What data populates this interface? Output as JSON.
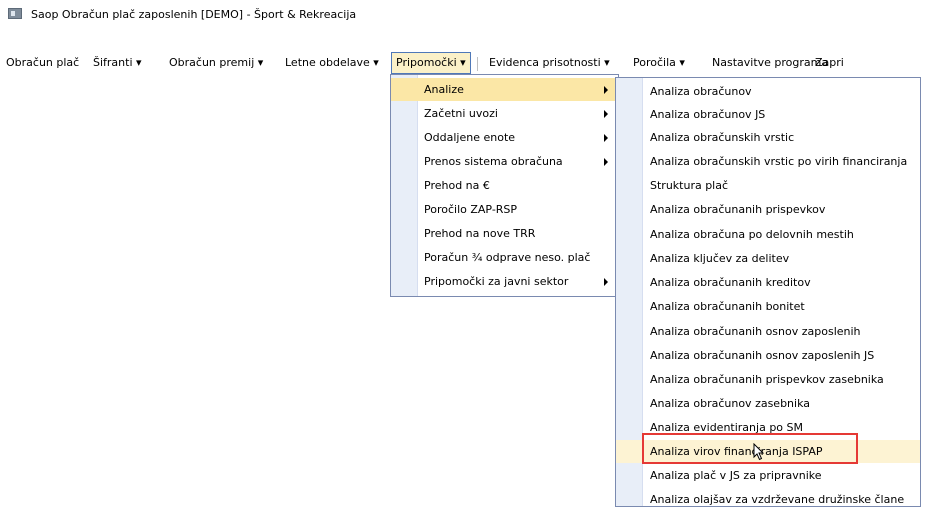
{
  "window": {
    "title": "Saop Obračun plač zaposlenih  [DEMO] - Šport & Rekreacija"
  },
  "menubar": {
    "items": [
      {
        "label": "Obračun plač"
      },
      {
        "label": "Šifranti ▾"
      },
      {
        "label": "Obračun premij ▾"
      },
      {
        "label": "Letne obdelave ▾"
      },
      {
        "label": "Pripomočki ▾"
      },
      {
        "label": "Evidenca prisotnosti ▾"
      },
      {
        "label": "Poročila ▾"
      },
      {
        "label": "Nastavitve programa"
      },
      {
        "label": "Zapri"
      }
    ]
  },
  "pripomocki_menu": {
    "items": [
      {
        "label": "Analize",
        "has_submenu": true
      },
      {
        "label": "Začetni uvozi",
        "has_submenu": true
      },
      {
        "label": "Oddaljene enote",
        "has_submenu": true
      },
      {
        "label": "Prenos sistema obračuna",
        "has_submenu": true
      },
      {
        "label": "Prehod na €"
      },
      {
        "label": "Poročilo ZAP-RSP"
      },
      {
        "label": "Prehod na nove TRR"
      },
      {
        "label": "Poračun ¾ odprave neso. plač"
      },
      {
        "label": "Pripomočki za javni sektor",
        "has_submenu": true
      }
    ]
  },
  "analize_submenu": {
    "items": [
      {
        "label": "Analiza obračunov"
      },
      {
        "label": "Analiza obračunov JS"
      },
      {
        "label": "Analiza obračunskih vrstic"
      },
      {
        "label": "Analiza obračunskih vrstic po virih financiranja"
      },
      {
        "label": "Struktura plač"
      },
      {
        "label": "Analiza obračunanih prispevkov"
      },
      {
        "label": "Analiza obračuna po delovnih mestih"
      },
      {
        "label": "Analiza ključev za delitev"
      },
      {
        "label": "Analiza obračunanih kreditov"
      },
      {
        "label": "Analiza obračunanih bonitet"
      },
      {
        "label": "Analiza obračunanih osnov zaposlenih"
      },
      {
        "label": "Analiza obračunanih osnov zaposlenih JS"
      },
      {
        "label": "Analiza obračunanih prispevkov zasebnika"
      },
      {
        "label": "Analiza obračunov zasebnika"
      },
      {
        "label": "Analiza evidentiranja po SM"
      },
      {
        "label": "Analiza virov financiranja ISPAP"
      },
      {
        "label": "Analiza plač v JS za pripravnike"
      },
      {
        "label": "Analiza olajšav za vzdrževane družinske člane"
      }
    ]
  },
  "colors": {
    "menu_highlight": "#fbe7a6",
    "menu_border": "#7a8ab0",
    "callout": "#e53935"
  }
}
